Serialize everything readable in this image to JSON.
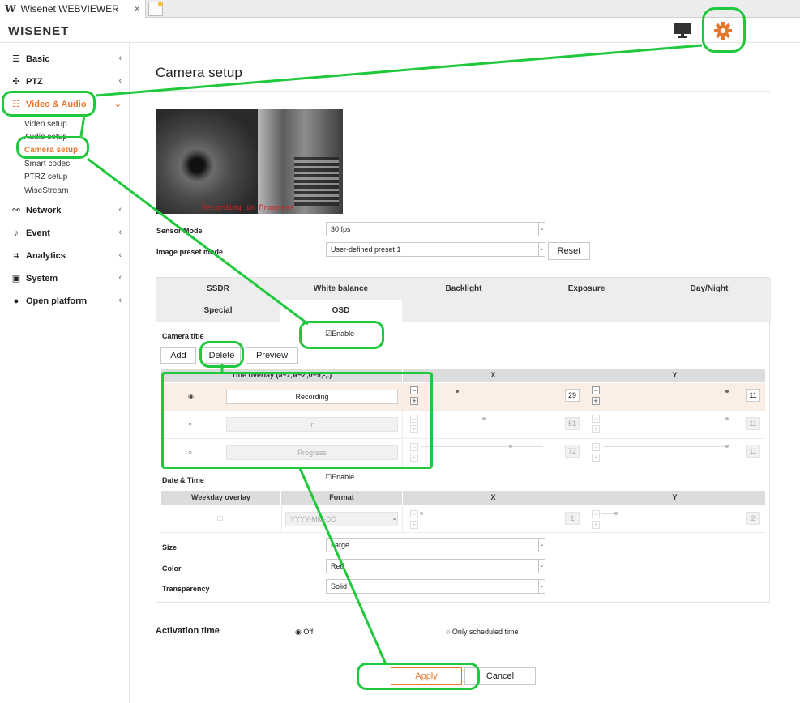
{
  "browser": {
    "tab_logo": "W",
    "tab_title": "Wisenet WEBVIEWER",
    "tab_close": "×"
  },
  "header": {
    "brand": "WISENET",
    "monitor_icon": "monitor-icon",
    "settings_icon": "gear-icon",
    "accent_color": "#e8772e"
  },
  "sidebar": {
    "items": [
      {
        "label": "Basic",
        "icon": "list-icon"
      },
      {
        "label": "PTZ",
        "icon": "move-icon"
      },
      {
        "label": "Video & Audio",
        "icon": "sliders-icon"
      },
      {
        "label": "Network",
        "icon": "network-icon"
      },
      {
        "label": "Event",
        "icon": "bell-icon"
      },
      {
        "label": "Analytics",
        "icon": "analytics-icon"
      },
      {
        "label": "System",
        "icon": "system-icon"
      },
      {
        "label": "Open platform",
        "icon": "platform-icon"
      }
    ],
    "sub_items": [
      "Video setup",
      "Audio setup",
      "Camera setup",
      "Smart codec",
      "PTRZ setup",
      "WiseStream"
    ],
    "chevron": "‹",
    "chevron_open": "⌄"
  },
  "main": {
    "title": "Camera setup",
    "video_osd_text": "Recording in Progress",
    "sensor_mode_label": "Sensor Mode",
    "sensor_mode_value": "30 fps",
    "preset_label": "Image preset mode",
    "preset_value": "User-defined preset 1",
    "reset_label": "Reset"
  },
  "tabs": {
    "row1": [
      "SSDR",
      "White balance",
      "Backlight",
      "Exposure",
      "Day/Night"
    ],
    "row2": [
      "Special",
      "OSD"
    ]
  },
  "osd": {
    "camera_title_label": "Camera title",
    "camera_title_enable": "☑Enable",
    "add_label": "Add",
    "delete_label": "Delete",
    "preview_label": "Preview",
    "col_title": "Title overlay (a~z,A~Z,0~9,-,.)",
    "col_x": "X",
    "col_y": "Y",
    "rows": [
      {
        "radio": "◉",
        "text": "Recording",
        "x": "29",
        "y": "11"
      },
      {
        "radio": "○",
        "text": "in",
        "x": "51",
        "y": "11"
      },
      {
        "radio": "○",
        "text": "Progress",
        "x": "72",
        "y": "11"
      }
    ],
    "date_time_label": "Date & Time",
    "date_time_enable": "☐Enable",
    "dt_col_weekday": "Weekday overlay",
    "dt_col_format": "Format",
    "dt_col_x": "X",
    "dt_col_y": "Y",
    "dt_row": {
      "check": "☐",
      "format": "YYYY-MM-DD",
      "x": "1",
      "y": "2"
    },
    "size_label": "Size",
    "size_value": "Large",
    "color_label": "Color",
    "color_value": "Red",
    "transparency_label": "Transparency",
    "transparency_value": "Solid",
    "plus": "+",
    "minus": "−",
    "caret": "⌄"
  },
  "activation": {
    "label": "Activation time",
    "off": "◉ Off",
    "scheduled": "○ Only scheduled time"
  },
  "footer": {
    "apply_label": "Apply",
    "cancel_label": "Cancel"
  },
  "annotation_color": "#20c83c"
}
